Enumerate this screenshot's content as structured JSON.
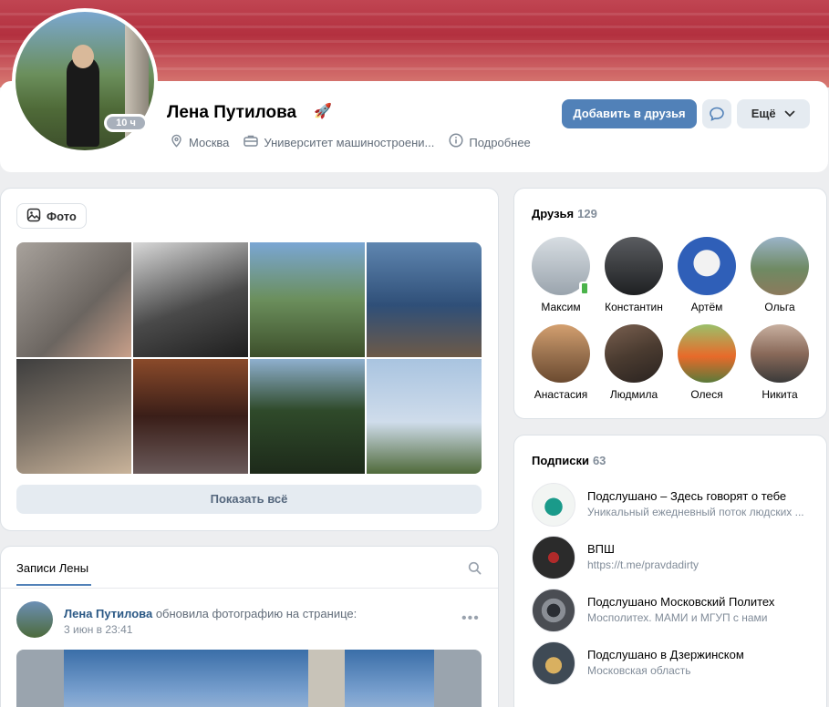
{
  "profile": {
    "name": "Лена Путилова",
    "online_badge": "10 ч",
    "city": "Москва",
    "university": "Университет машиностроени...",
    "details_label": "Подробнее",
    "add_friend_label": "Добавить в друзья",
    "more_label": "Ещё",
    "rocket_icon": "rocket-icon"
  },
  "photos": {
    "chip_label": "Фото",
    "show_all_label": "Показать всё",
    "colors": [
      "#8a8580",
      "#3c3c3c",
      "#6f8e5a",
      "#4e7090",
      "#5b5955",
      "#4a2a22",
      "#3b5530",
      "#9db6cf"
    ]
  },
  "wall": {
    "tab_label": "Записи Лены",
    "post": {
      "author": "Лена Путилова",
      "action": " обновила фотографию на странице:",
      "date": "3 июн в 23:41"
    }
  },
  "friends": {
    "title": "Друзья",
    "count": "129",
    "items": [
      {
        "name": "Максим",
        "color": "#b9c2c9"
      },
      {
        "name": "Константин",
        "color": "#303234"
      },
      {
        "name": "Артём",
        "color": "#2f5fb8"
      },
      {
        "name": "Ольга",
        "color": "#6f8a63"
      },
      {
        "name": "Анастасия",
        "color": "#9b7350"
      },
      {
        "name": "Людмила",
        "color": "#4a3b30"
      },
      {
        "name": "Олеся",
        "color": "#6a8a4a"
      },
      {
        "name": "Никита",
        "color": "#8a6a5a"
      }
    ]
  },
  "subscriptions": {
    "title": "Подписки",
    "count": "63",
    "items": [
      {
        "title": "Подслушано – Здесь говорят о тебе",
        "subtitle": "Уникальный ежедневный поток людских ...",
        "color": "#e8f3ef"
      },
      {
        "title": "ВПШ",
        "subtitle": "https://t.me/pravdadirty",
        "color": "#2b2b2b"
      },
      {
        "title": "Подслушано Московский Политех",
        "subtitle": "Мосполитех. МАМИ и МГУП с нами",
        "color": "#5b5f66"
      },
      {
        "title": "Подслушано в Дзержинском",
        "subtitle": "Московская область",
        "color": "#3f4a55"
      }
    ]
  }
}
